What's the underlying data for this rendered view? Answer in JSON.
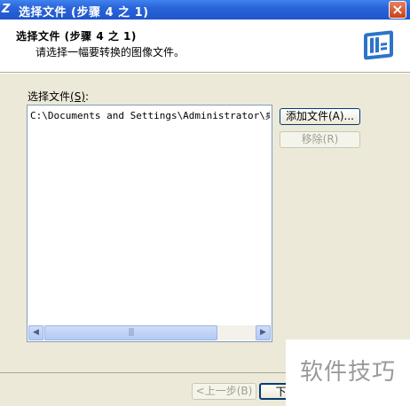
{
  "window": {
    "title": "选择文件 (步骤 4 之 1)",
    "close_glyph": "×",
    "app_icon_glyph": "Z"
  },
  "header": {
    "title": "选择文件 (步骤 4 之 1)",
    "subtitle": "请选择一幅要转换的图像文件。"
  },
  "files": {
    "label": "选择文件",
    "label_access": "(S)",
    "label_colon": ":",
    "items": [
      "C:\\Documents and Settings\\Administrator\\桌面\\..."
    ]
  },
  "buttons": {
    "add": "添加文件(A)...",
    "remove": "移除(R)",
    "back": "<上一步(B)",
    "next": "下一步"
  },
  "scrollbar": {
    "left_glyph": "◀",
    "right_glyph": "▶",
    "thumb_grip": "|||"
  },
  "watermark": {
    "text": "软件技巧"
  },
  "colors": {
    "title_bar": "#2a64d8",
    "dialog_bg": "#ece9d8",
    "close_btn": "#c8411a"
  }
}
